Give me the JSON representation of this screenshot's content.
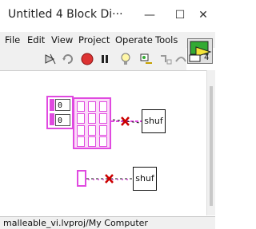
{
  "window": {
    "title": "Untitled 4 Block Di···",
    "minimize": "—",
    "maximize": "☐",
    "close": "✕"
  },
  "menu": {
    "items": [
      "File",
      "Edit",
      "View",
      "Project",
      "Operate",
      "Tools"
    ]
  },
  "toolbar": {
    "icons": [
      "run-arrow-icon",
      "run-continuously-icon",
      "abort-icon",
      "pause-icon",
      "highlight-execution-icon",
      "retain-wire-values-icon",
      "step-into-icon",
      "step-over-icon"
    ]
  },
  "vi_icon": {
    "number": "4"
  },
  "diagram": {
    "array_constant_values": [
      "0",
      "0"
    ],
    "subvi_top_label": "shuf",
    "subvi_bottom_label": "shuf"
  },
  "status": {
    "path": "malleable_vi.lvproj/My Computer"
  },
  "colors": {
    "array_wire": "#e04ae0",
    "broken_wire": "#cc0000",
    "chrome": "#f0f0f0"
  }
}
